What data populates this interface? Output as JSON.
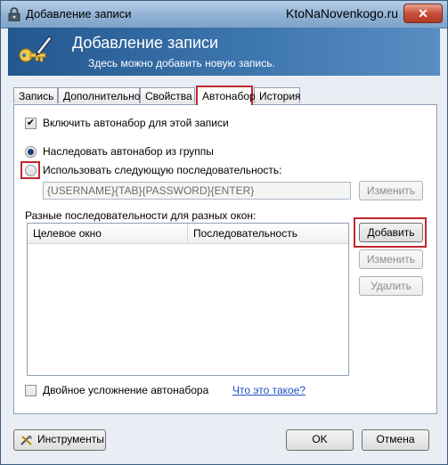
{
  "window": {
    "title": "Добавление записи",
    "watermark": "KtoNaNovenkogo.ru",
    "close_label": "✕"
  },
  "banner": {
    "title": "Добавление записи",
    "subtitle": "Здесь можно добавить новую запись."
  },
  "tabs": [
    {
      "label": "Запись"
    },
    {
      "label": "Дополнительно"
    },
    {
      "label": "Свойства"
    },
    {
      "label": "Автонабор",
      "active": true
    },
    {
      "label": "История"
    }
  ],
  "autotype": {
    "enable_label": "Включить автонабор для этой записи",
    "enable_checked": true,
    "inherit_label": "Наследовать автонабор из группы",
    "inherit_selected": true,
    "custom_label": "Использовать следующую последовательность:",
    "custom_selected": false,
    "sequence_value": "{USERNAME}{TAB}{PASSWORD}{ENTER}",
    "edit_sequence_label": "Изменить",
    "windows_label": "Разные последовательности для разных окон:",
    "columns": [
      "Целевое окно",
      "Последовательность"
    ],
    "add_label": "Добавить",
    "edit_label": "Изменить",
    "delete_label": "Удалить",
    "obfuscation_label": "Двойное усложнение автонабора",
    "obfuscation_checked": false,
    "help_link": "Что это такое?"
  },
  "footer": {
    "tools_label": "Инструменты",
    "ok_label": "OK",
    "cancel_label": "Отмена"
  },
  "colors": {
    "highlight": "#c0272d",
    "banner": "#3f78b0",
    "link": "#1c4ec2"
  }
}
